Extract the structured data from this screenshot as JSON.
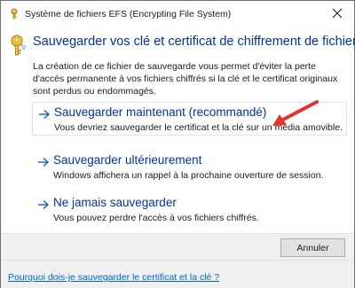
{
  "window": {
    "title": "Système de fichiers EFS (Encrypting File System)",
    "close_icon": "close-icon"
  },
  "header": {
    "icon": "key-icon",
    "heading": "Sauvegarder vos clé et certificat de chiffrement de fichiers",
    "description": "La création de ce fichier de sauvegarde vous permet d'éviter la perte d'accès permanente à vos fichiers chiffrés si la clé et le certificat originaux sont perdus ou endommagés."
  },
  "options": [
    {
      "title": "Sauvegarder maintenant (recommandé)",
      "description": "Vous devriez sauvegarder le certificat et la clé sur un média amovible.",
      "selected": true
    },
    {
      "title": "Sauvegarder ultérieurement",
      "description": "Windows affichera un rappel à la prochaine ouverture de session.",
      "selected": false
    },
    {
      "title": "Ne jamais sauvegarder",
      "description": "Vous pouvez perdre l'accès à vos fichiers chiffrés.",
      "selected": false
    }
  ],
  "buttons": {
    "cancel_label": "Annuler"
  },
  "footer": {
    "help_link": "Pourquoi dois-je sauvegarder le certificat et la clé ?"
  },
  "colors": {
    "link_blue": "#003399",
    "annotation_red": "#e8332c"
  }
}
